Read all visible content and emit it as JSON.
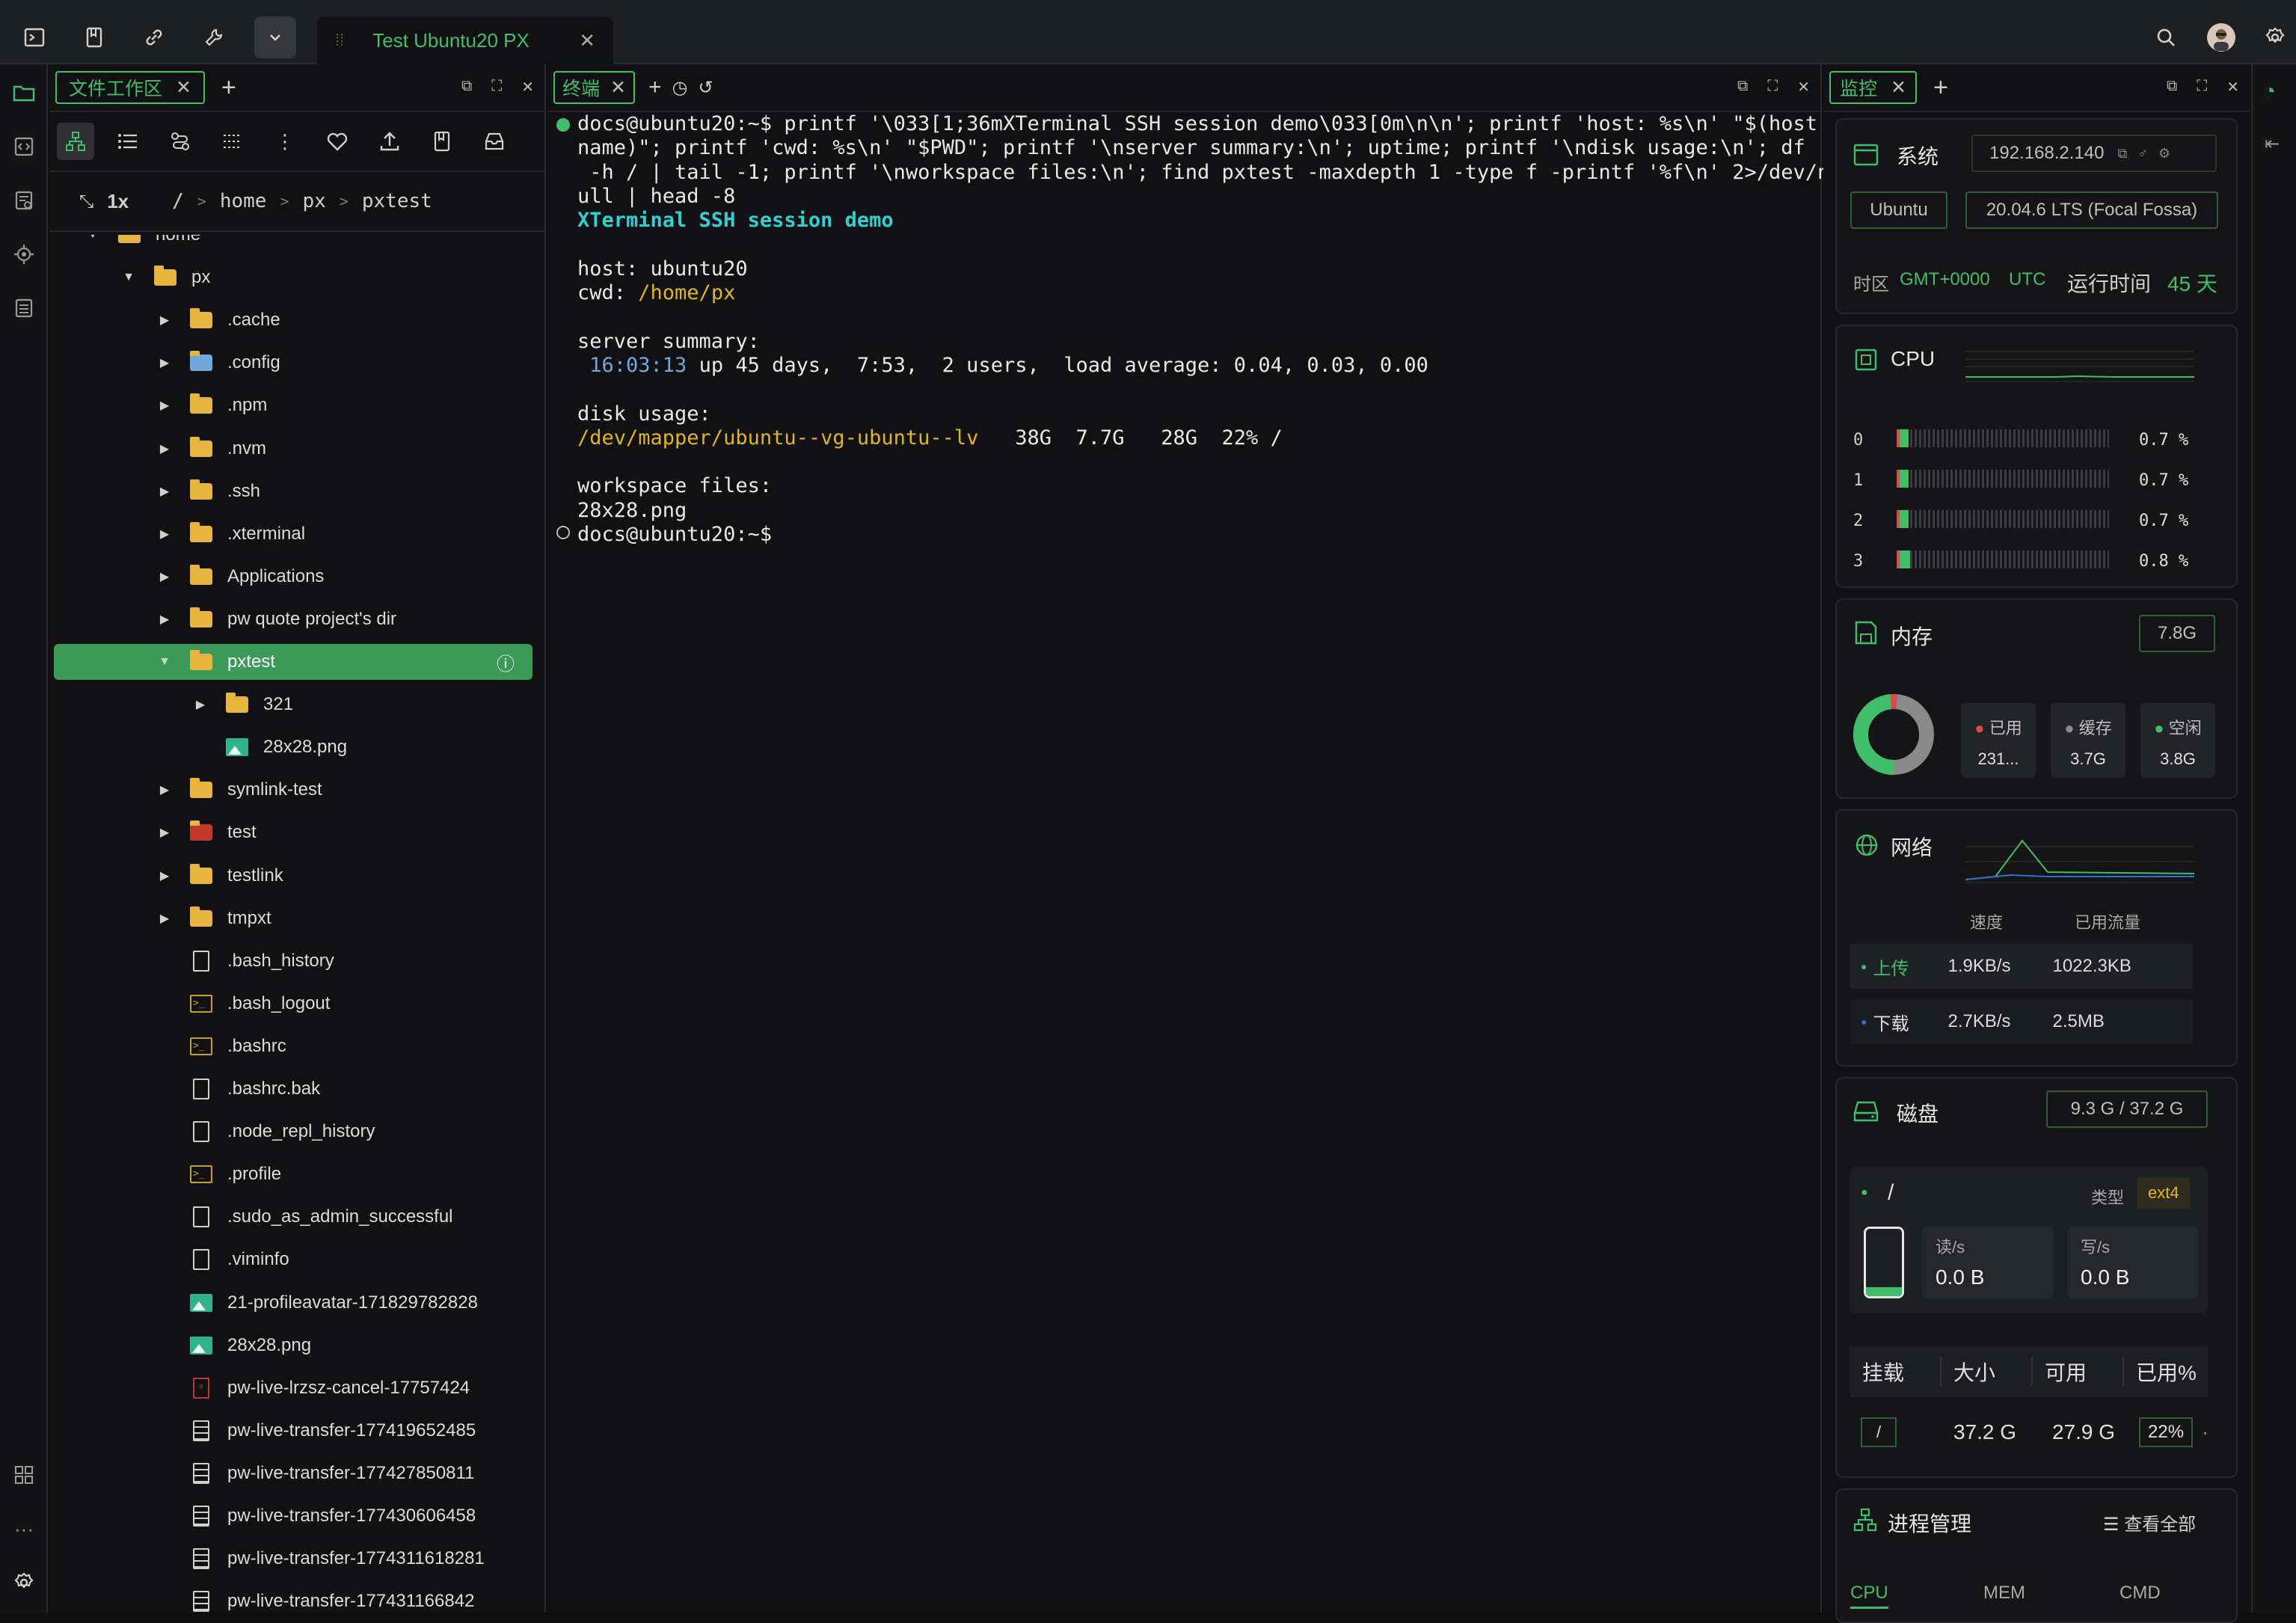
{
  "tab": {
    "title": "Test Ubuntu20 PX"
  },
  "file_panel": {
    "tab_label": "文件工作区",
    "zoom": "1x",
    "breadcrumb": [
      "/",
      "home",
      "px",
      "pxtest"
    ],
    "tree": [
      {
        "label": "home",
        "kind": "folder",
        "depth": 0,
        "caret": "open"
      },
      {
        "label": "px",
        "kind": "folder",
        "depth": 1,
        "caret": "open"
      },
      {
        "label": ".cache",
        "kind": "folder",
        "depth": 2,
        "caret": "closed"
      },
      {
        "label": ".config",
        "kind": "folder-gear",
        "depth": 2,
        "caret": "closed"
      },
      {
        "label": ".npm",
        "kind": "folder",
        "depth": 2,
        "caret": "closed"
      },
      {
        "label": ".nvm",
        "kind": "folder",
        "depth": 2,
        "caret": "closed"
      },
      {
        "label": ".ssh",
        "kind": "folder",
        "depth": 2,
        "caret": "closed"
      },
      {
        "label": ".xterminal",
        "kind": "folder",
        "depth": 2,
        "caret": "closed"
      },
      {
        "label": "Applications",
        "kind": "folder",
        "depth": 2,
        "caret": "closed"
      },
      {
        "label": "pw quote project's dir",
        "kind": "folder",
        "depth": 2,
        "caret": "closed"
      },
      {
        "label": "pxtest",
        "kind": "folder",
        "depth": 2,
        "caret": "open",
        "selected": true
      },
      {
        "label": "321",
        "kind": "folder",
        "depth": 3,
        "caret": "closed"
      },
      {
        "label": "28x28.png",
        "kind": "image",
        "depth": 3,
        "caret": ""
      },
      {
        "label": "symlink-test",
        "kind": "folder",
        "depth": 2,
        "caret": "closed"
      },
      {
        "label": "test",
        "kind": "folder-red",
        "depth": 2,
        "caret": "closed"
      },
      {
        "label": "testlink",
        "kind": "folder",
        "depth": 2,
        "caret": "closed"
      },
      {
        "label": "tmpxt",
        "kind": "folder",
        "depth": 2,
        "caret": "closed"
      },
      {
        "label": ".bash_history",
        "kind": "file",
        "depth": 2,
        "caret": ""
      },
      {
        "label": ".bash_logout",
        "kind": "shell",
        "depth": 2,
        "caret": ""
      },
      {
        "label": ".bashrc",
        "kind": "shell",
        "depth": 2,
        "caret": ""
      },
      {
        "label": ".bashrc.bak",
        "kind": "file",
        "depth": 2,
        "caret": ""
      },
      {
        "label": ".node_repl_history",
        "kind": "file",
        "depth": 2,
        "caret": ""
      },
      {
        "label": ".profile",
        "kind": "shell",
        "depth": 2,
        "caret": ""
      },
      {
        "label": ".sudo_as_admin_successful",
        "kind": "file",
        "depth": 2,
        "caret": ""
      },
      {
        "label": ".viminfo",
        "kind": "file",
        "depth": 2,
        "caret": ""
      },
      {
        "label": "21-profileavatar-171829782828",
        "kind": "image",
        "depth": 2,
        "caret": ""
      },
      {
        "label": "28x28.png",
        "kind": "image",
        "depth": 2,
        "caret": ""
      },
      {
        "label": "pw-live-lrzsz-cancel-17757424",
        "kind": "pdf",
        "depth": 2,
        "caret": ""
      },
      {
        "label": "pw-live-transfer-177419652485",
        "kind": "doc",
        "depth": 2,
        "caret": ""
      },
      {
        "label": "pw-live-transfer-177427850811",
        "kind": "doc",
        "depth": 2,
        "caret": ""
      },
      {
        "label": "pw-live-transfer-177430606458",
        "kind": "doc",
        "depth": 2,
        "caret": ""
      },
      {
        "label": "pw-live-transfer-1774311618281",
        "kind": "doc",
        "depth": 2,
        "caret": ""
      },
      {
        "label": "pw-live-transfer-177431166842",
        "kind": "doc",
        "depth": 2,
        "caret": ""
      }
    ]
  },
  "terminal": {
    "tab_label": "终端",
    "lines": [
      {
        "parts": [
          {
            "t": "docs@ubuntu20:~$ printf '\\033[1;36mXTerminal SSH session demo\\033[0m\\n\\n'; printf 'host: %s\\n' \"$(host"
          }
        ]
      },
      {
        "parts": [
          {
            "t": "name)\"; printf 'cwd: %s\\n' \"$PWD\"; printf '\\nserver summary:\\n'; uptime; printf '\\ndisk usage:\\n'; df"
          }
        ]
      },
      {
        "parts": [
          {
            "t": " -h / | tail -1; printf '\\nworkspace files:\\n'; find pxtest -maxdepth 1 -type f -printf '%f\\n' 2>/dev/n"
          }
        ]
      },
      {
        "parts": [
          {
            "t": "ull | head -8"
          }
        ]
      },
      {
        "parts": [
          {
            "t": "XTerminal SSH session demo",
            "c": "c-cyan"
          }
        ]
      },
      {
        "parts": [
          {
            "t": ""
          }
        ]
      },
      {
        "parts": [
          {
            "t": "host: ubuntu20"
          }
        ]
      },
      {
        "parts": [
          {
            "t": "cwd: "
          },
          {
            "t": "/home/px",
            "c": "c-yel"
          }
        ]
      },
      {
        "parts": [
          {
            "t": ""
          }
        ]
      },
      {
        "parts": [
          {
            "t": "server summary:"
          }
        ]
      },
      {
        "parts": [
          {
            "t": " "
          },
          {
            "t": "16:03:13",
            "c": "c-blue"
          },
          {
            "t": " up 45 days,  7:53,  2 users,  load average: 0.04, 0.03, 0.00"
          }
        ]
      },
      {
        "parts": [
          {
            "t": ""
          }
        ]
      },
      {
        "parts": [
          {
            "t": "disk usage:"
          }
        ]
      },
      {
        "parts": [
          {
            "t": "/dev/mapper/ubuntu--vg-ubuntu--lv",
            "c": "c-yel"
          },
          {
            "t": "   38G  7.7G   28G  22% /"
          }
        ]
      },
      {
        "parts": [
          {
            "t": ""
          }
        ]
      },
      {
        "parts": [
          {
            "t": "workspace files:"
          }
        ]
      },
      {
        "parts": [
          {
            "t": "28x28.png"
          }
        ]
      },
      {
        "parts": [
          {
            "t": "docs@ubuntu20:~$ "
          }
        ]
      }
    ]
  },
  "monitor": {
    "tab_label": "监控",
    "system": {
      "title": "系统",
      "ip": "192.168.2.140",
      "os": "Ubuntu",
      "version": "20.04.6 LTS (Focal Fossa)",
      "tz_label": "时区",
      "tz": "GMT+0000",
      "tz_name": "UTC",
      "uptime_label": "运行时间",
      "uptime": "45 天"
    },
    "cpu": {
      "title": "CPU",
      "cores": [
        {
          "id": "0",
          "pct": "0.7 %",
          "level": 0.007
        },
        {
          "id": "1",
          "pct": "0.7 %",
          "level": 0.007
        },
        {
          "id": "2",
          "pct": "0.7 %",
          "level": 0.007
        },
        {
          "id": "3",
          "pct": "0.8 %",
          "level": 0.008
        }
      ]
    },
    "memory": {
      "title": "内存",
      "total": "7.8G",
      "used_label": "已用",
      "used": "231...",
      "cache_label": "缓存",
      "cache": "3.7G",
      "free_label": "空闲",
      "free": "3.8G"
    },
    "network": {
      "title": "网络",
      "col_speed": "速度",
      "col_total": "已用流量",
      "up_label": "上传",
      "up_speed": "1.9KB/s",
      "up_total": "1022.3KB",
      "down_label": "下载",
      "down_speed": "2.7KB/s",
      "down_total": "2.5MB"
    },
    "disk": {
      "title": "磁盘",
      "summary": "9.3 G / 37.2 G",
      "mount": "/",
      "type_label": "类型",
      "type": "ext4",
      "read_label": "读/s",
      "read": "0.0 B",
      "write_label": "写/s",
      "write": "0.0 B",
      "level": 0.22,
      "headers": [
        "挂载",
        "大小",
        "可用",
        "已用%"
      ],
      "row": {
        "mount": "/",
        "size": "37.2 G",
        "avail": "27.9 G",
        "used_pct": "22%"
      }
    },
    "process": {
      "title": "进程管理",
      "view_all": "查看全部",
      "cols": [
        "CPU",
        "MEM",
        "CMD"
      ]
    }
  },
  "colors": {
    "accent": "#3fbf6a",
    "folder": "#e7b53e",
    "selected_row": "#3b9a57"
  }
}
